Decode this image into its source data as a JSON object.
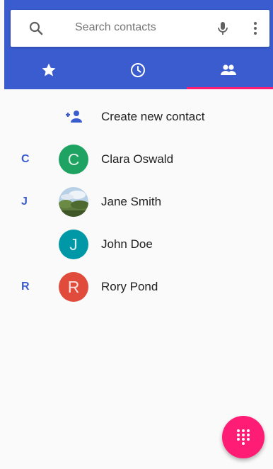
{
  "search": {
    "placeholder": "Search contacts",
    "left_icon": "search-icon",
    "mic_icon": "mic-icon",
    "menu_icon": "more-vert-icon"
  },
  "tabs": [
    {
      "icon": "star-icon",
      "selected": false
    },
    {
      "icon": "clock-icon",
      "selected": false
    },
    {
      "icon": "people-icon",
      "selected": true
    }
  ],
  "create_contact": {
    "label": "Create new contact",
    "icon": "add-person-icon"
  },
  "contacts": [
    {
      "letter": "C",
      "initial": "C",
      "name": "Clara Oswald",
      "avatar_color": "#1ea362"
    },
    {
      "letter": "J",
      "initial": "",
      "name": "Jane Smith",
      "avatar_color": "photo"
    },
    {
      "letter": "",
      "initial": "J",
      "name": "John Doe",
      "avatar_color": "#0097a7"
    },
    {
      "letter": "R",
      "initial": "R",
      "name": "Rory Pond",
      "avatar_color": "#e04b3b"
    }
  ],
  "fab": {
    "icon": "dialpad-icon"
  },
  "colors": {
    "primary": "#3a5ccf",
    "accent": "#ff1c74",
    "background": "#fafafa"
  }
}
